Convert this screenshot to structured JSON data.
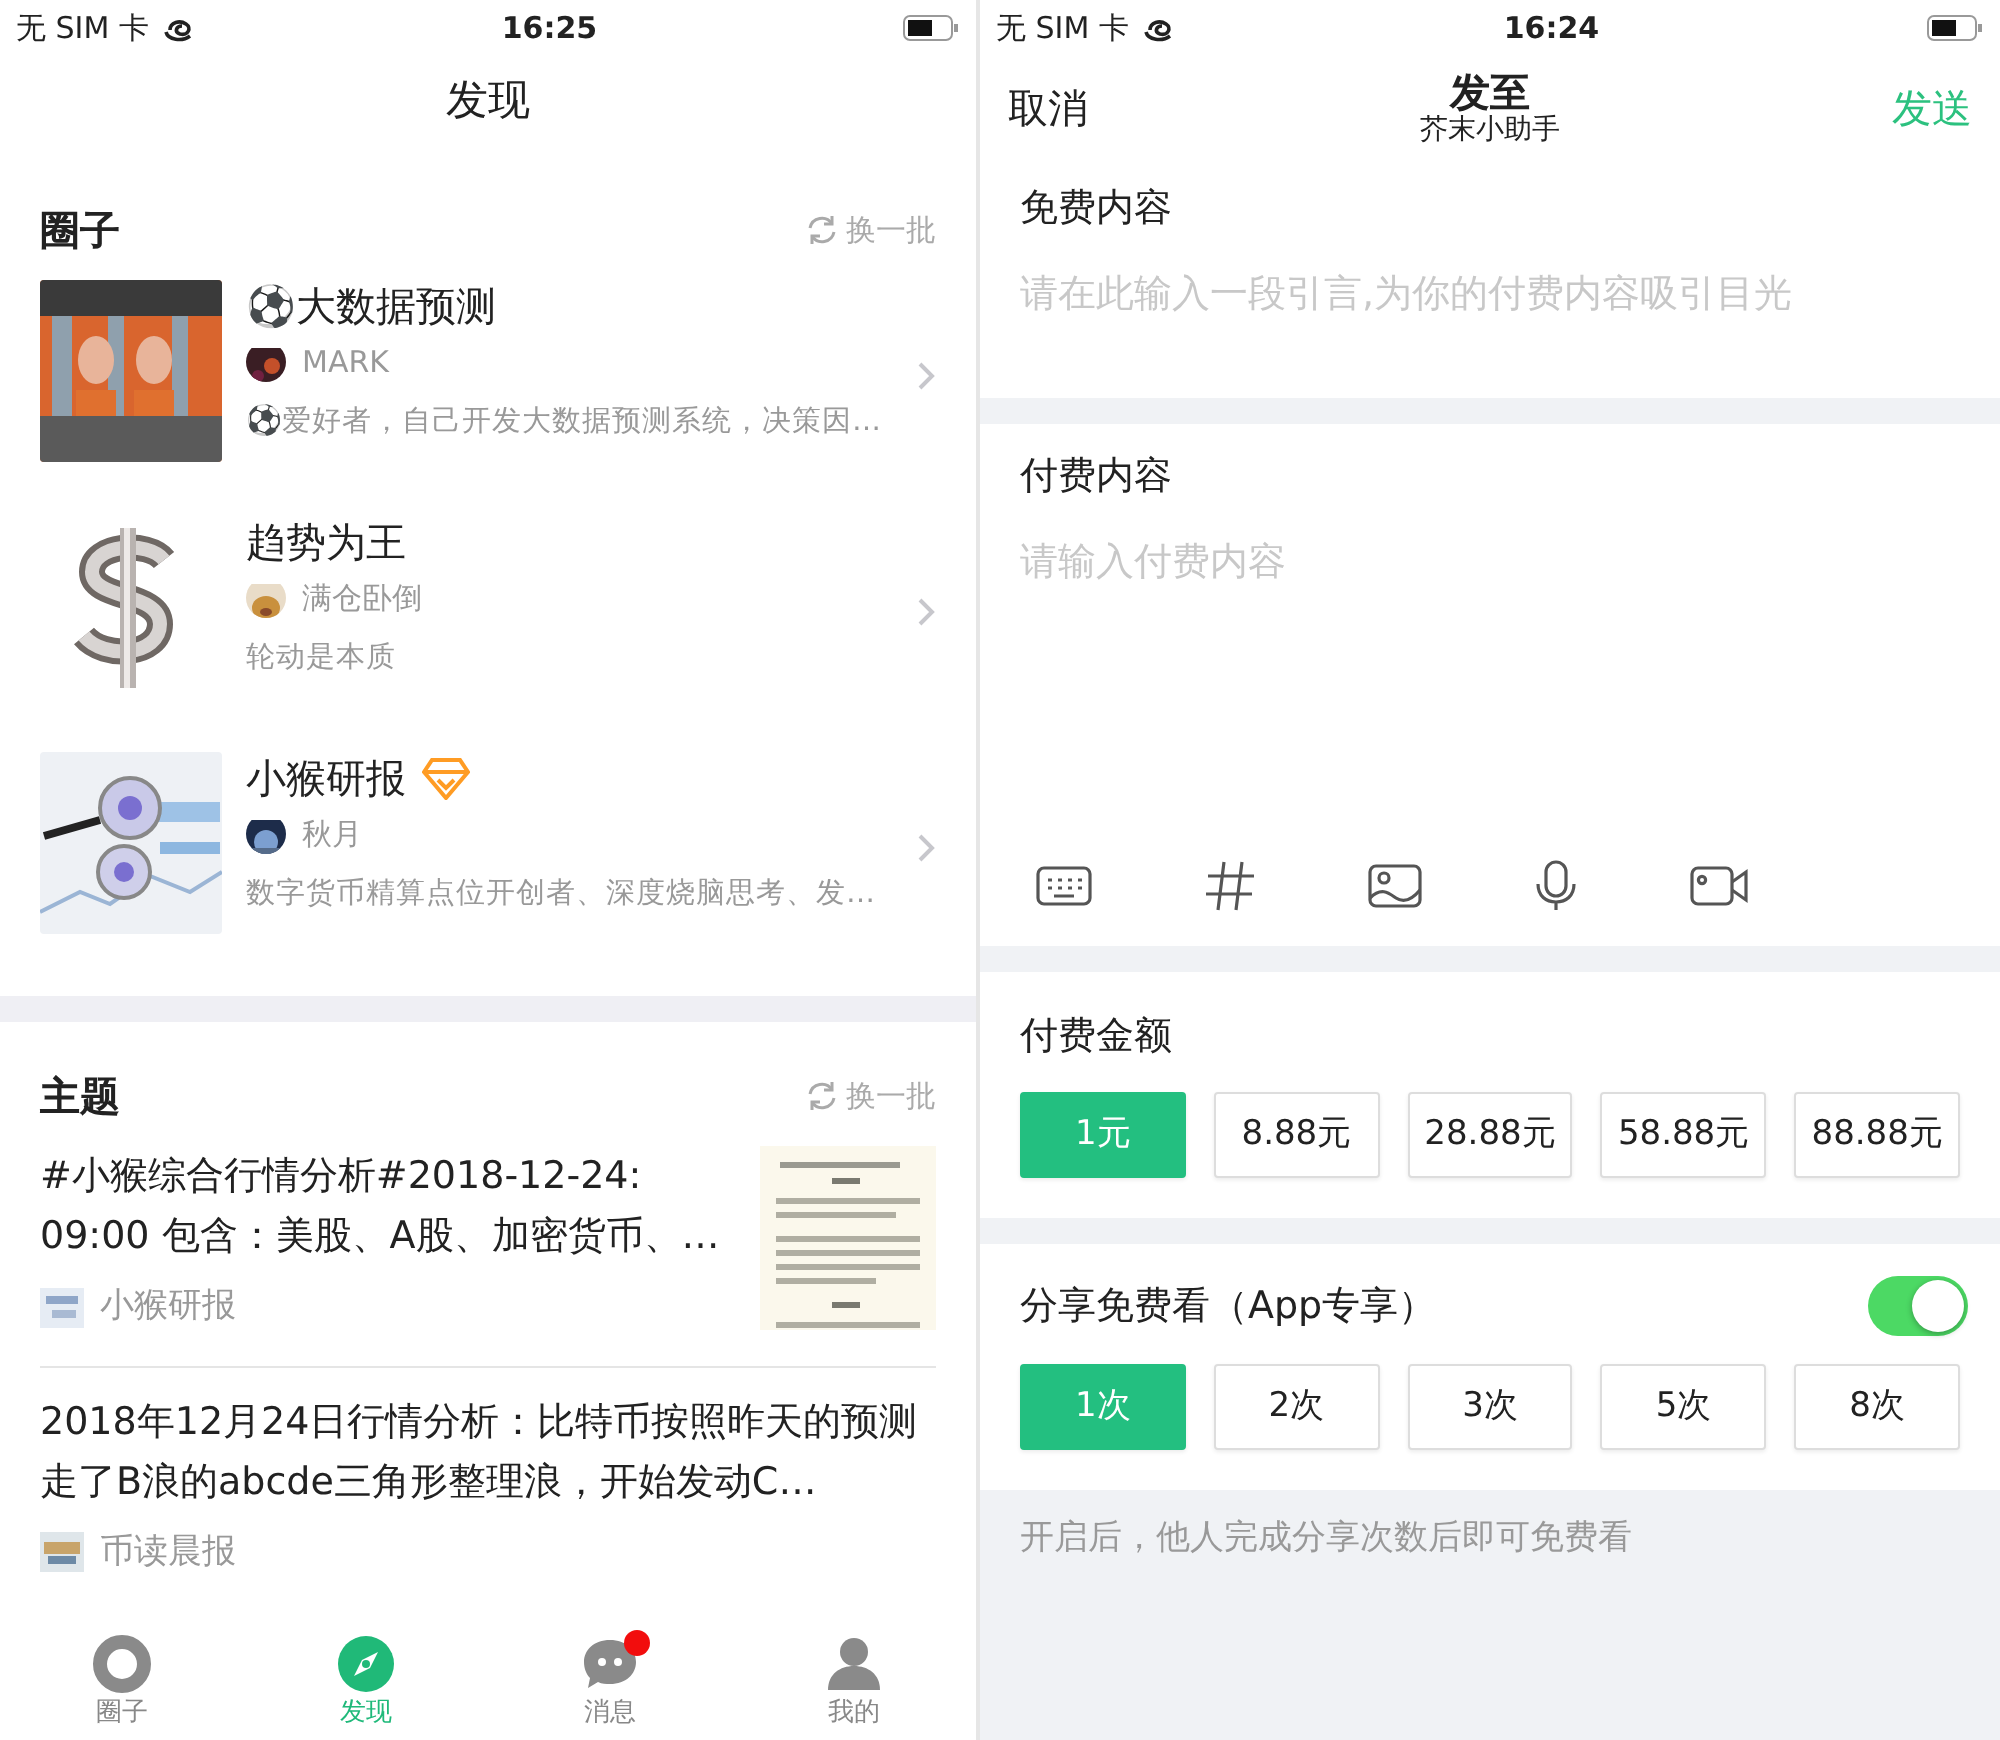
{
  "left": {
    "status_bar": {
      "carrier": "无 SIM 卡",
      "time": "16:25"
    },
    "title": "发现",
    "circles": {
      "title": "圈子",
      "refresh": "换一批",
      "items": [
        {
          "name": "⚽大数据预测",
          "owner": "MARK",
          "desc": "⚽爱好者，自己开发大数据预测系统，决策因…",
          "premium": false
        },
        {
          "name": "趋势为王",
          "owner": "满仓卧倒",
          "desc": "轮动是本质",
          "premium": false
        },
        {
          "name": "小猴研报",
          "owner": "秋月",
          "desc": "数字货币精算点位开创者、深度烧脑思考、发…",
          "premium": true
        }
      ]
    },
    "topics": {
      "title": "主题",
      "refresh": "换一批",
      "items": [
        {
          "text": "#小猴综合行情分析#2018-12-24: 09:00 包含：美股、A股、加密货币、…",
          "source": "小猴研报",
          "thumbnail": true
        },
        {
          "text": "2018年12月24日行情分析：比特币按照昨天的预测走了B浪的abcde三角形整理浪，开始发动C…",
          "source": "币读晨报",
          "thumbnail": false
        }
      ]
    },
    "tab_bar": [
      {
        "label": "圈子",
        "kind": "ring",
        "selected": false,
        "badge": false
      },
      {
        "label": "发现",
        "kind": "compass",
        "selected": true,
        "badge": false
      },
      {
        "label": "消息",
        "kind": "chat",
        "selected": false,
        "badge": true
      },
      {
        "label": "我的",
        "kind": "person",
        "selected": false,
        "badge": false
      }
    ]
  },
  "right": {
    "status_bar": {
      "carrier": "无 SIM 卡",
      "time": "16:24"
    },
    "nav": {
      "cancel": "取消",
      "title": "发至",
      "subtitle": "芥末小助手",
      "send": "发送"
    },
    "free_content": {
      "label": "免费内容",
      "placeholder": "请在此输入一段引言,为你的付费内容吸引目光"
    },
    "paid_content": {
      "label": "付费内容",
      "placeholder": "请输入付费内容"
    },
    "price": {
      "label": "付费金额",
      "options": [
        {
          "label": "1元",
          "selected": true
        },
        {
          "label": "8.88元",
          "selected": false
        },
        {
          "label": "28.88元",
          "selected": false
        },
        {
          "label": "58.88元",
          "selected": false
        },
        {
          "label": "88.88元",
          "selected": false
        }
      ]
    },
    "share": {
      "label": "分享免费看（App专享）",
      "on": true,
      "options": [
        {
          "label": "1次",
          "selected": true
        },
        {
          "label": "2次",
          "selected": false
        },
        {
          "label": "3次",
          "selected": false
        },
        {
          "label": "5次",
          "selected": false
        },
        {
          "label": "8次",
          "selected": false
        }
      ]
    },
    "note": "开启后，他人完成分享次数后即可免费看"
  }
}
